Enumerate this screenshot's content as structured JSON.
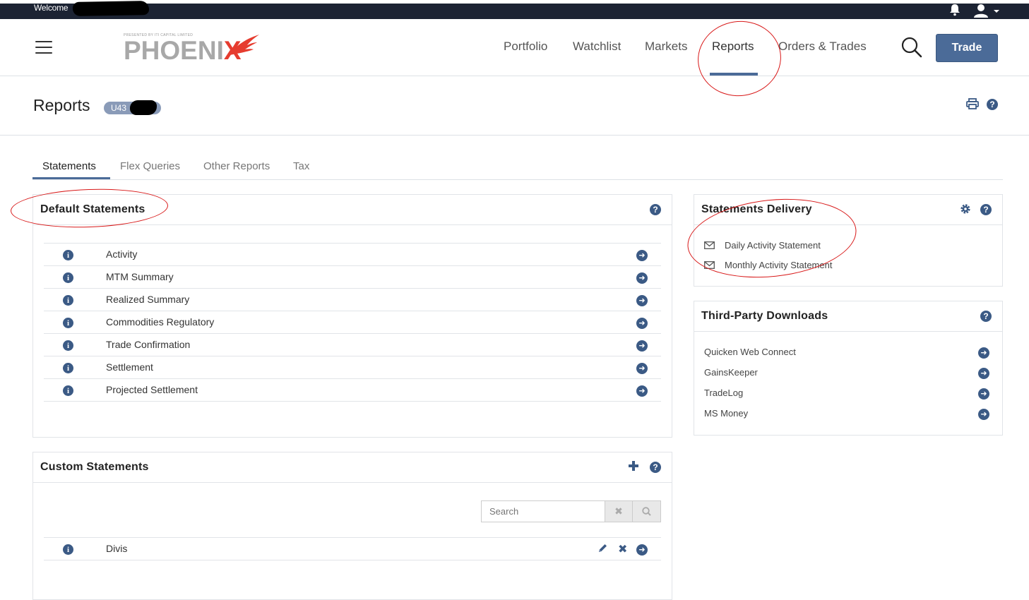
{
  "topbar": {
    "welcome": "Welcome"
  },
  "header": {
    "logo_tagline": "PRESENTED BY ITI CAPITAL LIMITED",
    "logo_main": "PHOENI",
    "logo_x": "X",
    "nav": [
      "Portfolio",
      "Watchlist",
      "Markets",
      "Reports",
      "Orders & Trades"
    ],
    "trade_label": "Trade"
  },
  "page": {
    "title": "Reports",
    "account_prefix": "U43"
  },
  "tabs": [
    "Statements",
    "Flex Queries",
    "Other Reports",
    "Tax"
  ],
  "default_statements": {
    "title": "Default Statements",
    "items": [
      "Activity",
      "MTM Summary",
      "Realized Summary",
      "Commodities Regulatory",
      "Trade Confirmation",
      "Settlement",
      "Projected Settlement"
    ]
  },
  "statements_delivery": {
    "title": "Statements Delivery",
    "items": [
      "Daily Activity Statement",
      "Monthly Activity Statement"
    ]
  },
  "third_party": {
    "title": "Third-Party Downloads",
    "items": [
      "Quicken Web Connect",
      "GainsKeeper",
      "TradeLog",
      "MS Money"
    ]
  },
  "custom_statements": {
    "title": "Custom Statements",
    "search_placeholder": "Search",
    "items": [
      "Divis"
    ]
  },
  "colors": {
    "primary": "#4b6b98",
    "icon": "#3b5a85",
    "topbar": "#1c2333",
    "logo_x": "#e63c2f",
    "annotation": "#d81818"
  }
}
